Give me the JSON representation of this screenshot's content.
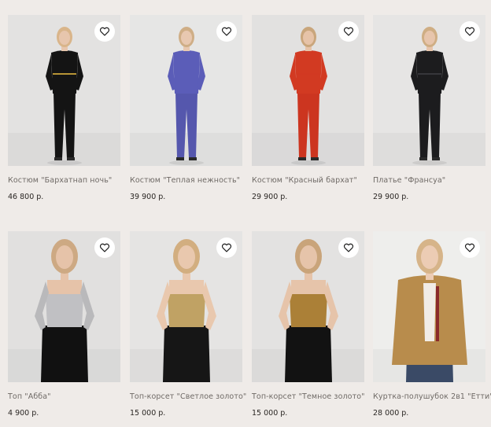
{
  "products": [
    {
      "name": "Костюм \"Бархатнап ночь\"",
      "price": "46 800 р.",
      "bg": "#e3e2e1",
      "top": "#141414",
      "bottom": "#141414",
      "skin": "#e7c6ad",
      "hair": "#d9b58a",
      "accent": "#c9a23a"
    },
    {
      "name": "Костюм \"Теплая нежность\"",
      "price": "39 900 р.",
      "bg": "#e6e6e5",
      "top": "#5b5db8",
      "bottom": "#5557ad",
      "skin": "#e8c8b0",
      "hair": "#cfae86",
      "accent": "#5b5db8"
    },
    {
      "name": "Костюм \"Красный бархат\"",
      "price": "29 900 р.",
      "bg": "#e2e1e0",
      "top": "#d23a22",
      "bottom": "#cc3520",
      "skin": "#e6c3a8",
      "hair": "#c9a67c",
      "accent": "#d23a22"
    },
    {
      "name": "Платье \"Франсуа\"",
      "price": "29 900 р.",
      "bg": "#e6e5e4",
      "top": "#1c1c1e",
      "bottom": "#1c1c1e",
      "skin": "#e7c5ac",
      "hair": "#cfae84",
      "accent": "#3a3a3e"
    },
    {
      "name": "Топ \"Абба\"",
      "price": "4 900 р.",
      "bg": "#e1e0df",
      "top": "#b9b9bb",
      "bottom": "#111111",
      "skin": "#e6c3a9",
      "hair": "#cda983",
      "accent": "#d8d8da"
    },
    {
      "name": "Топ-корсет \"Светлое золото\"",
      "price": "15 000 р.",
      "bg": "#e5e4e3",
      "top": "#b89a5c",
      "bottom": "#161616",
      "skin": "#e9c8ae",
      "hair": "#d2ae80",
      "accent": "#d9bd7c"
    },
    {
      "name": "Топ-корсет \"Темное золото\"",
      "price": "15 000 р.",
      "bg": "#e3e2e1",
      "top": "#a57a32",
      "bottom": "#121212",
      "skin": "#e6c4aa",
      "hair": "#c9a47a",
      "accent": "#c19446"
    },
    {
      "name": "Куртка-полушубок 2в1 \"Етти\"",
      "price": "28 000 р.",
      "bg": "#eeeeec",
      "top": "#b88c4c",
      "bottom": "#3a4a66",
      "skin": "#ecccb4",
      "hair": "#d6b489",
      "accent": "#8a2a2a"
    }
  ]
}
